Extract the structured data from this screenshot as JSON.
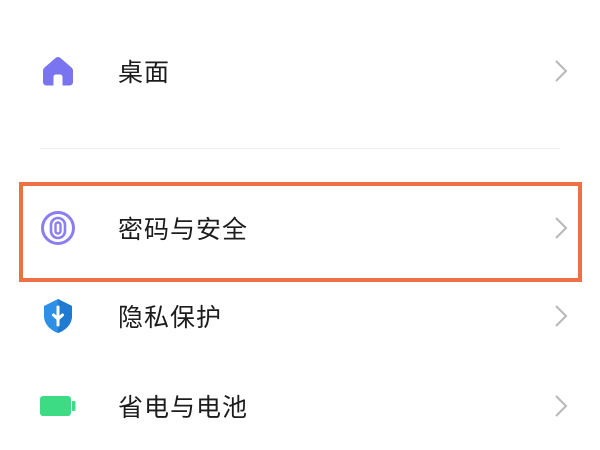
{
  "settings": {
    "items": [
      {
        "label": "桌面",
        "icon": "home-icon",
        "icon_color": "#7b74f0"
      },
      {
        "label": "密码与安全",
        "icon": "fingerprint-icon",
        "icon_color": "#8a7ef2"
      },
      {
        "label": "隐私保护",
        "icon": "shield-icon",
        "icon_color": "#2d8fe6"
      },
      {
        "label": "省电与电池",
        "icon": "battery-icon",
        "icon_color": "#3ddc84"
      }
    ],
    "chevron_icon": "chevron-right-icon",
    "highlight_color": "#ee7046",
    "highlighted_item": "密码与安全"
  }
}
